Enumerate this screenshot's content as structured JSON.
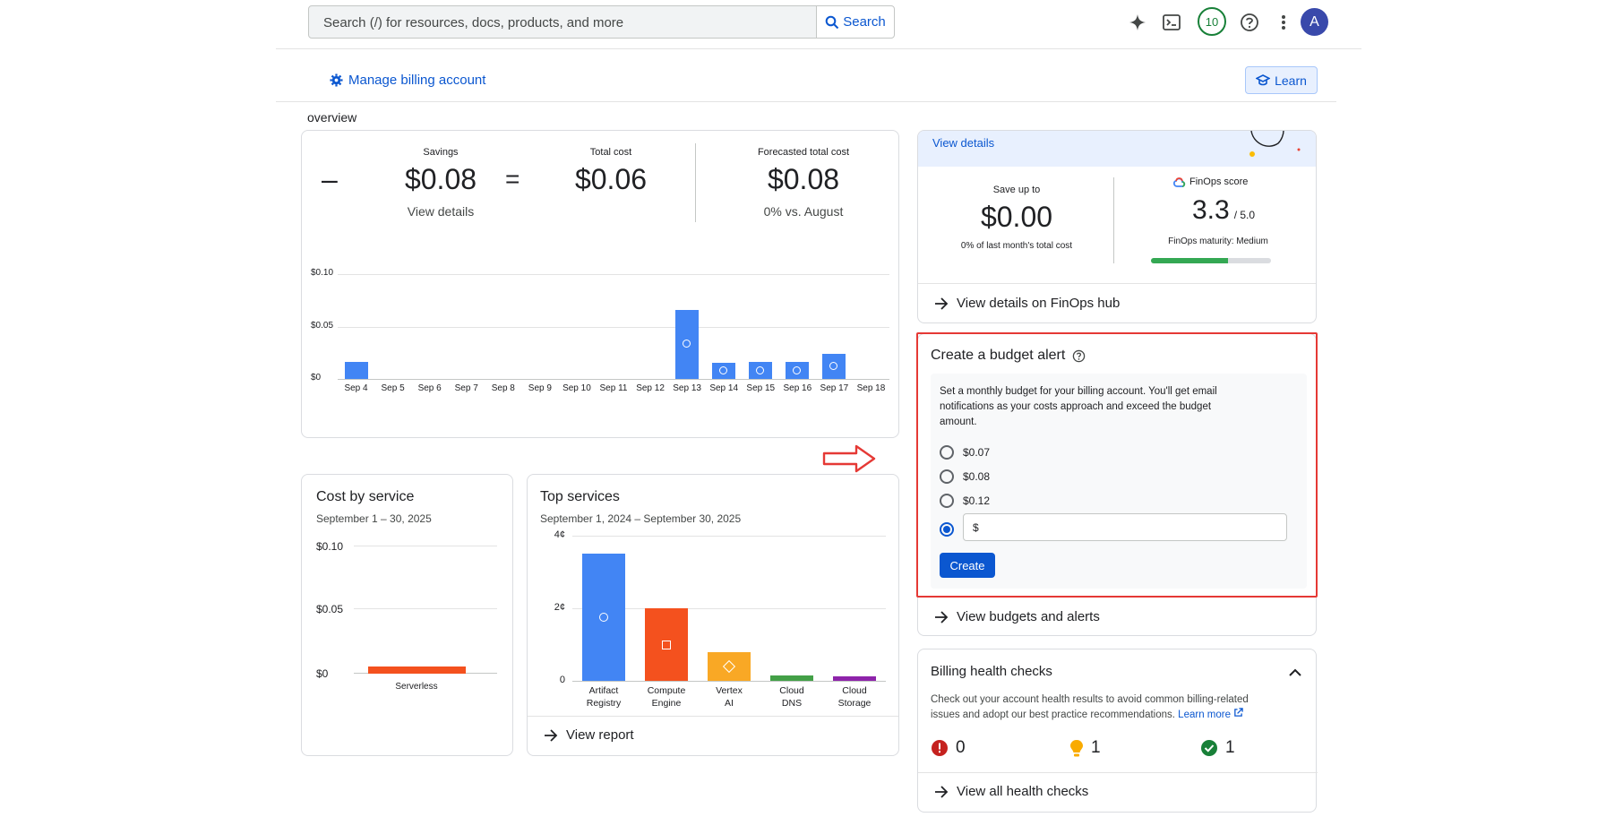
{
  "header": {
    "search_placeholder": "Search (/) for resources, docs, products, and more",
    "search_button": "Search",
    "notifications_count": "10",
    "avatar_letter": "A"
  },
  "toolbar": {
    "manage_label": "Manage billing account",
    "learn_label": "Learn"
  },
  "overview": {
    "title": "overview",
    "minus": "–",
    "equals": "=",
    "savings_label": "Savings",
    "savings_value": "$0.08",
    "savings_link": "View details",
    "total_label": "Total cost",
    "total_value": "$0.06",
    "forecast_label": "Forecasted total cost",
    "forecast_value": "$0.08",
    "forecast_sub": "0% vs. August"
  },
  "daily_chart": {
    "type": "bar",
    "y_ticks": [
      "$0.10",
      "$0.05",
      "$0"
    ],
    "ylim": [
      0,
      0.1
    ],
    "categories": [
      "Sep 4",
      "Sep 5",
      "Sep 6",
      "Sep 7",
      "Sep 8",
      "Sep 9",
      "Sep 10",
      "Sep 11",
      "Sep 12",
      "Sep 13",
      "Sep 14",
      "Sep 15",
      "Sep 16",
      "Sep 17",
      "Sep 18"
    ],
    "values": [
      0.016,
      0,
      0,
      0,
      0,
      0,
      0,
      0,
      0,
      0.066,
      0.015,
      0.016,
      0.016,
      0.024,
      0
    ],
    "color": "#4285f4"
  },
  "cost_by_service": {
    "title": "Cost by service",
    "date_range": "September 1 – 30, 2025",
    "y_ticks": [
      "$0.10",
      "$0.05",
      "$0"
    ],
    "category": "Serverless",
    "color": "#f4511e"
  },
  "top_services": {
    "title": "Top services",
    "date_range": "September 1, 2024 – September 30, 2025",
    "y_ticks": [
      "4¢",
      "2¢",
      "0"
    ],
    "link": "View report"
  },
  "chart_data": {
    "type": "bar",
    "categories": [
      "Artifact Registry",
      "Compute Engine",
      "Vertex AI",
      "Cloud DNS",
      "Cloud Storage"
    ],
    "values": [
      3.5,
      2.0,
      0.8,
      0.15,
      0.12
    ],
    "colors": [
      "#4285f4",
      "#f4511e",
      "#f9a825",
      "#43a047",
      "#8e24aa"
    ],
    "ylabel": "",
    "ylim": [
      0,
      4
    ]
  },
  "finops": {
    "view_details": "View details",
    "save_label": "Save up to",
    "save_value": "$0.00",
    "save_sub": "0% of last month's total cost",
    "score_label": "FinOps score",
    "score_value": "3.3",
    "score_max": "/ 5.0",
    "maturity": "FinOps maturity: Medium",
    "maturity_fraction": 0.64,
    "hub_link": "View details on FinOps hub"
  },
  "budget": {
    "title": "Create a budget alert",
    "description": "Set a monthly budget for your billing account. You'll get email notifications as your costs approach and exceed the budget amount.",
    "options": [
      "$0.07",
      "$0.08",
      "$0.12"
    ],
    "custom_placeholder": "$",
    "create_label": "Create",
    "view_link": "View budgets and alerts"
  },
  "health": {
    "title": "Billing health checks",
    "description": "Check out your account health results to avoid common billing-related issues and adopt our best practice recommendations.",
    "learn_more": "Learn more",
    "error_count": "0",
    "warning_count": "1",
    "ok_count": "1",
    "view_all": "View all health checks"
  }
}
